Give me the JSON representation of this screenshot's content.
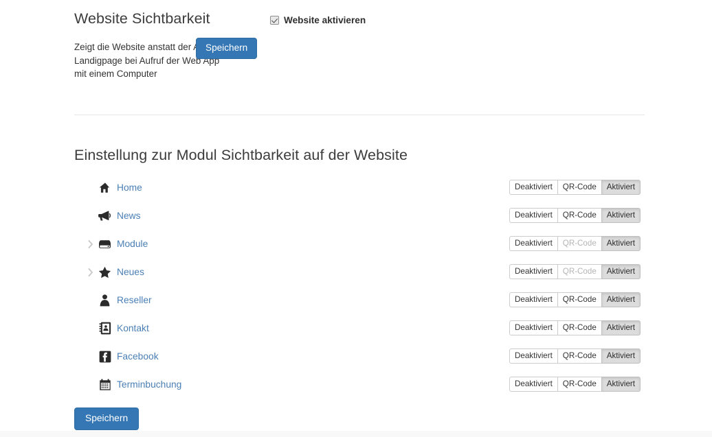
{
  "visibility_section": {
    "title": "Website Sichtbarkeit",
    "description": "Zeigt die Website anstatt der App-Landigpage bei Aufruf der Web App mit einem Computer",
    "checkbox_label": "Website aktivieren",
    "checkbox_checked": true,
    "save_label": "Speichern"
  },
  "module_section": {
    "title": "Einstellung zur Modul Sichtbarkeit auf der Website",
    "save_label": "Speichern",
    "toggle_labels": {
      "off": "Deaktiviert",
      "qr": "QR-Code",
      "on": "Aktiviert"
    },
    "rows": [
      {
        "label": "Home",
        "icon": "home-icon",
        "expandable": false,
        "state": "on",
        "qr_disabled": false
      },
      {
        "label": "News",
        "icon": "megaphone-icon",
        "expandable": false,
        "state": "on",
        "qr_disabled": false
      },
      {
        "label": "Module",
        "icon": "drive-icon",
        "expandable": true,
        "state": "on",
        "qr_disabled": true
      },
      {
        "label": "Neues",
        "icon": "star-icon",
        "expandable": true,
        "state": "on",
        "qr_disabled": true
      },
      {
        "label": "Reseller",
        "icon": "person-icon",
        "expandable": false,
        "state": "on",
        "qr_disabled": false
      },
      {
        "label": "Kontakt",
        "icon": "contact-book-icon",
        "expandable": false,
        "state": "on",
        "qr_disabled": false
      },
      {
        "label": "Facebook",
        "icon": "facebook-icon",
        "expandable": false,
        "state": "on",
        "qr_disabled": false
      },
      {
        "label": "Terminbuchung",
        "icon": "calendar-icon",
        "expandable": false,
        "state": "on",
        "qr_disabled": false
      }
    ]
  },
  "colors": {
    "primary_button": "#3577b5",
    "link": "#4a7fb5",
    "active_toggle_bg": "#dcdcdc",
    "divider": "#e6e6e6"
  }
}
